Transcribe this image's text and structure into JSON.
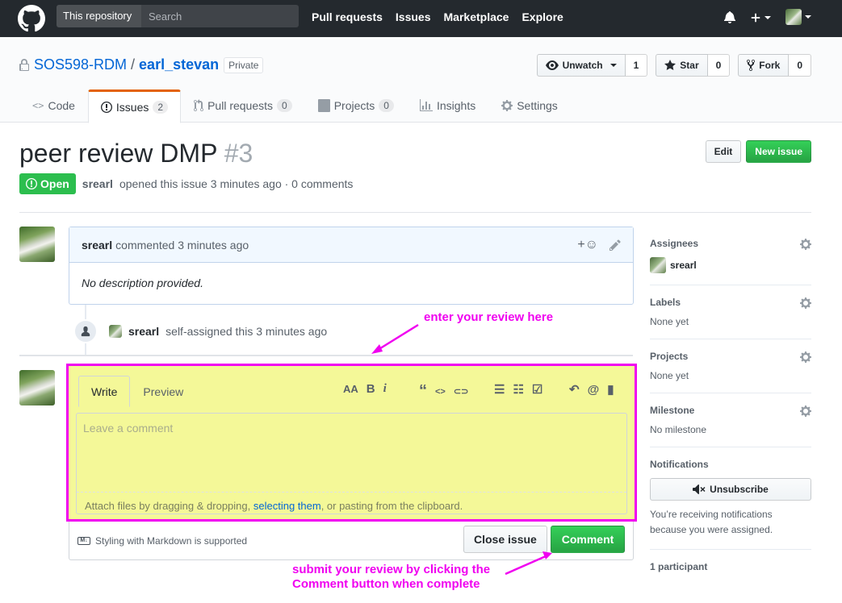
{
  "header": {
    "scope_label": "This repository",
    "search_placeholder": "Search",
    "nav": [
      "Pull requests",
      "Issues",
      "Marketplace",
      "Explore"
    ]
  },
  "repo": {
    "owner": "SOS598-RDM",
    "name": "earl_stevan",
    "visibility": "Private",
    "watch_label": "Unwatch",
    "watch_count": "1",
    "star_label": "Star",
    "star_count": "0",
    "fork_label": "Fork",
    "fork_count": "0",
    "tabs": [
      {
        "label": "Code",
        "icon": "code-icon"
      },
      {
        "label": "Issues",
        "icon": "issue-opened-icon",
        "counter": "2"
      },
      {
        "label": "Pull requests",
        "icon": "git-pull-request-icon",
        "counter": "0"
      },
      {
        "label": "Projects",
        "icon": "project-icon",
        "counter": "0"
      },
      {
        "label": "Insights",
        "icon": "graph-icon"
      },
      {
        "label": "Settings",
        "icon": "gear-icon"
      }
    ]
  },
  "issue": {
    "title": "peer review DMP",
    "number": "#3",
    "edit_label": "Edit",
    "new_issue_label": "New issue",
    "state": "Open",
    "author": "srearl",
    "meta": "opened this issue 3 minutes ago · 0 comments"
  },
  "comment": {
    "author": "srearl",
    "time": "commented 3 minutes ago",
    "body": "No description provided."
  },
  "event": {
    "author": "srearl",
    "text": "self-assigned this 3 minutes ago"
  },
  "form": {
    "write_tab": "Write",
    "preview_tab": "Preview",
    "placeholder": "Leave a comment",
    "hint_before": "Attach files by dragging & dropping, ",
    "hint_link": "selecting them",
    "hint_after": ", or pasting from the clipboard.",
    "markdown_note": "Styling with Markdown is supported",
    "close_label": "Close issue",
    "comment_label": "Comment",
    "toolbar": {
      "heading": "AA",
      "bold": "B",
      "italic": "i",
      "quote": "“",
      "code": "<>",
      "link": "⊂⊃",
      "bullets": "☰",
      "numbers": "☷",
      "tasks": "☑",
      "reply": "↶",
      "mention": "@",
      "bookmark": "▮"
    }
  },
  "annotations": {
    "enter_review": "enter your review here",
    "submit_line1": "submit your review by clicking the",
    "submit_line2": "Comment button when complete",
    "color": "#f000f0"
  },
  "sidebar": {
    "assignees_label": "Assignees",
    "assignee_name": "srearl",
    "labels_label": "Labels",
    "labels_value": "None yet",
    "projects_label": "Projects",
    "projects_value": "None yet",
    "milestone_label": "Milestone",
    "milestone_value": "No milestone",
    "notifications_label": "Notifications",
    "unsubscribe_label": "Unsubscribe",
    "notif_note": "You’re receiving notifications because you were assigned.",
    "participants_label": "1 participant"
  },
  "colors": {
    "header_bg": "#24292e",
    "open_green": "#2cbe4e",
    "tab_accent": "#e36209",
    "highlight_fill": "#f4f898",
    "highlight_border": "#f000f0"
  }
}
